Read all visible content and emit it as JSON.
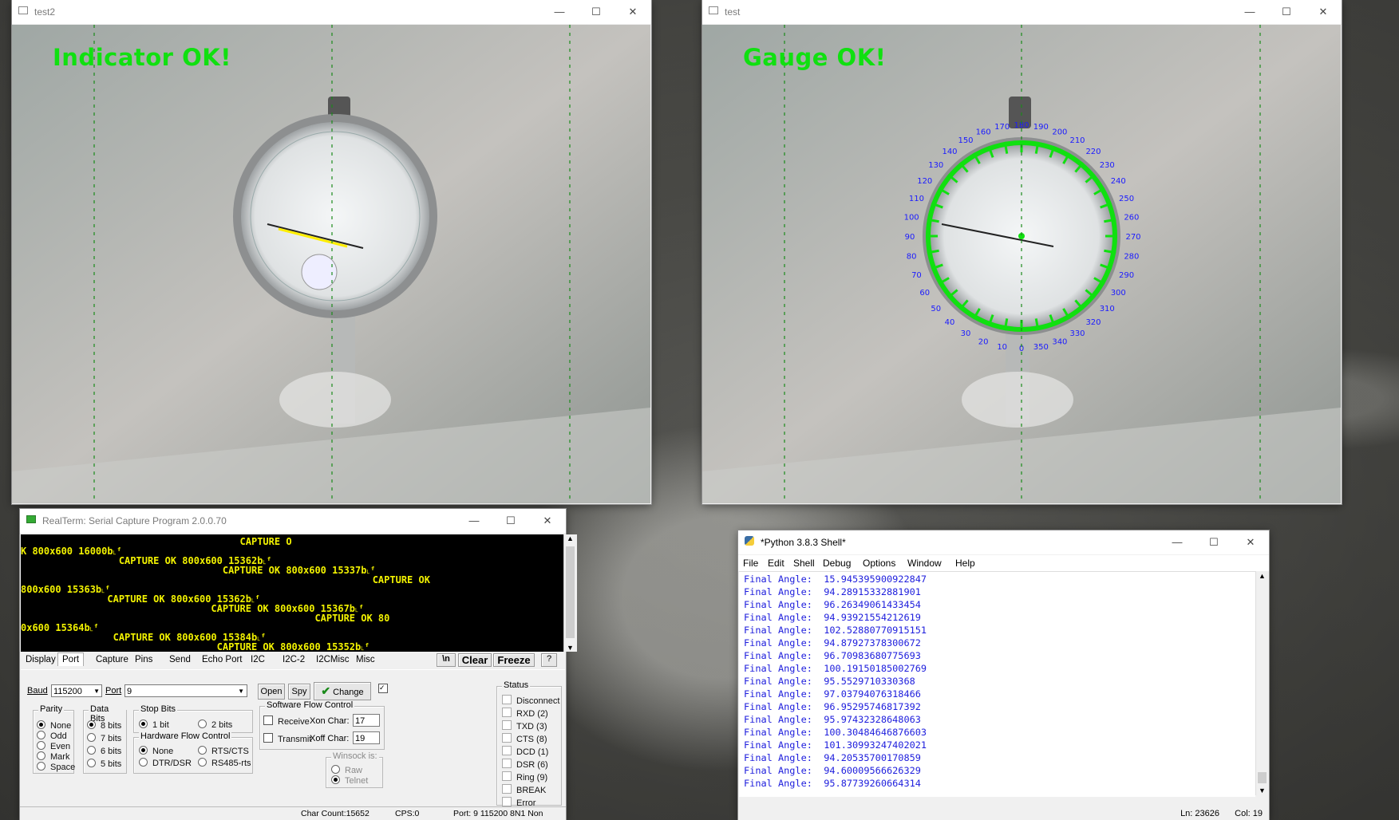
{
  "windows": {
    "test2": {
      "title": "test2",
      "overlay": "Indicator OK!"
    },
    "test": {
      "title": "test",
      "overlay": "Gauge OK!"
    }
  },
  "gauge_scale": [
    "0",
    "10",
    "20",
    "30",
    "40",
    "50",
    "60",
    "70",
    "80",
    "90",
    "100",
    "110",
    "120",
    "130",
    "140",
    "150",
    "160",
    "170",
    "180",
    "190",
    "200",
    "210",
    "220",
    "230",
    "240",
    "250",
    "260",
    "270",
    "280",
    "290",
    "300",
    "310",
    "320",
    "330",
    "340",
    "350"
  ],
  "realterm": {
    "title": "RealTerm: Serial Capture Program 2.0.0.70",
    "lines": [
      "                                      CAPTURE O",
      "K 800x600 16000b˪ᶠ",
      "                 CAPTURE OK 800x600 15362b˪ᶠ",
      "                                   CAPTURE OK 800x600 15337b˪ᶠ",
      "                                                             CAPTURE OK",
      "800x600 15363b˪ᶠ",
      "               CAPTURE OK 800x600 15362b˪ᶠ",
      "                                 CAPTURE OK 800x600 15367b˪ᶠ",
      "                                                   CAPTURE OK 80",
      "0x600 15364b˪ᶠ",
      "                CAPTURE OK 800x600 15384b˪ᶠ",
      "                                  CAPTURE OK 800x600 15352b˪ᶠ"
    ],
    "tabs": [
      "Display",
      "Port",
      "Capture",
      "Pins",
      "Send",
      "Echo Port",
      "I2C",
      "I2C-2",
      "I2CMisc",
      "Misc"
    ],
    "buttons": {
      "newline": "\\n",
      "clear": "Clear",
      "freeze": "Freeze",
      "help": "?",
      "open": "Open",
      "spy": "Spy",
      "change": "Change"
    },
    "baud_label": "Baud",
    "baud_value": "115200",
    "port_label": "Port",
    "port_value": "9",
    "parity": {
      "title": "Parity",
      "options": [
        "None",
        "Odd",
        "Even",
        "Mark",
        "Space"
      ],
      "selected": "None"
    },
    "data_bits": {
      "title": "Data Bits",
      "options": [
        "8 bits",
        "7 bits",
        "6 bits",
        "5 bits"
      ],
      "selected": "8 bits"
    },
    "stop_bits": {
      "title": "Stop Bits",
      "options": [
        "1 bit",
        "2 bits"
      ],
      "selected": "1 bit"
    },
    "hw_flow": {
      "title": "Hardware Flow Control",
      "options": [
        "None",
        "RTS/CTS",
        "DTR/DSR",
        "RS485-rts"
      ],
      "selected": "None"
    },
    "sw_flow": {
      "title": "Software Flow Control",
      "receive": "Receive",
      "transmit": "Transmit",
      "xon_label": "Xon Char:",
      "xon": "17",
      "xoff_label": "Xoff Char:",
      "xoff": "19"
    },
    "winsock": {
      "title": "Winsock is:",
      "options": [
        "Raw",
        "Telnet"
      ],
      "selected": "Telnet"
    },
    "status": {
      "title": "Status",
      "items": [
        "Disconnect",
        "RXD (2)",
        "TXD (3)",
        "CTS (8)",
        "DCD (1)",
        "DSR (6)",
        "Ring (9)",
        "BREAK",
        "Error"
      ]
    },
    "statusbar": {
      "char_count": "Char Count:15652",
      "cps": "CPS:0",
      "port": "Port: 9 115200 8N1 Non"
    }
  },
  "python": {
    "title": "*Python 3.8.3 Shell*",
    "menu": [
      "File",
      "Edit",
      "Shell",
      "Debug",
      "Options",
      "Window",
      "Help"
    ],
    "label": "Final Angle:",
    "values": [
      "15.945395900922847",
      "94.28915332881901",
      "96.26349061433454",
      "94.93921554212619",
      "102.52880770915151",
      "94.87927378300672",
      "96.70983680775693",
      "100.19150185002769",
      "95.5529710330368",
      "97.03794076318466",
      "96.95295746817392",
      "95.97432328648063",
      "100.30484646876603",
      "101.30993247402021",
      "94.20535700170859",
      "94.60009566626329",
      "95.87739260664314"
    ],
    "status_ln": "Ln: 23626",
    "status_col": "Col: 19"
  },
  "colors": {
    "overlay_green": "#10e010",
    "terminal_yellow": "#f2f200",
    "shell_blue": "#2020dd",
    "needle_yellow": "#ffee00",
    "scale_blue": "#1a1aff"
  }
}
